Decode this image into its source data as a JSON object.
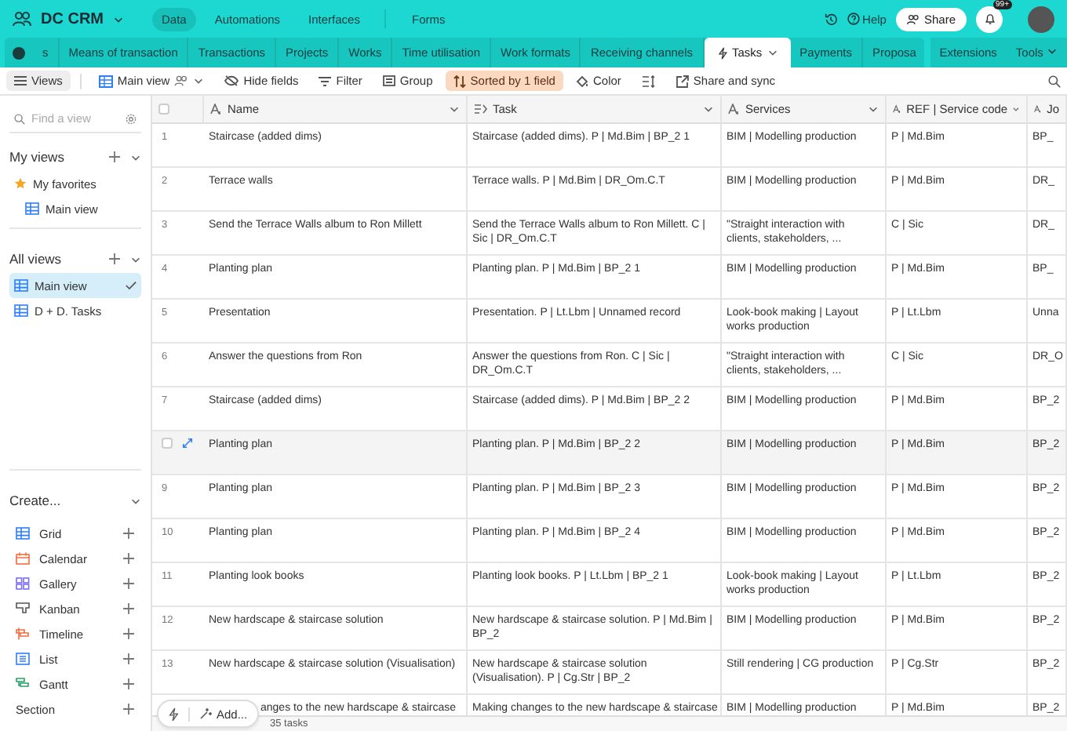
{
  "topbar": {
    "base_name": "DC CRM",
    "nav": [
      {
        "label": "Data",
        "selected": true
      },
      {
        "label": "Automations",
        "selected": false
      },
      {
        "label": "Interfaces",
        "selected": false
      },
      {
        "label": "Forms",
        "selected": false
      }
    ],
    "help": "Help",
    "share": "Share",
    "notification_badge": "99+"
  },
  "tables": {
    "tabs": [
      {
        "label": "s",
        "selected": false
      },
      {
        "label": "Means of transaction",
        "selected": false
      },
      {
        "label": "Transactions",
        "selected": false
      },
      {
        "label": "Projects",
        "selected": false
      },
      {
        "label": "Works",
        "selected": false
      },
      {
        "label": "Time utilisation",
        "selected": false
      },
      {
        "label": "Work formats",
        "selected": false
      },
      {
        "label": "Receiving channels",
        "selected": false
      },
      {
        "label": "Tasks",
        "selected": true
      },
      {
        "label": "Payments",
        "selected": false
      },
      {
        "label": "Proposa",
        "selected": false
      }
    ],
    "extensions": "Extensions",
    "tools": "Tools"
  },
  "toolbar": {
    "items": [
      {
        "label": "Views",
        "kind": "views",
        "active": false
      },
      {
        "label": "Main view",
        "kind": "view",
        "active": false
      },
      {
        "label": "Hide fields",
        "kind": "hide",
        "active": false
      },
      {
        "label": "Filter",
        "kind": "filter",
        "active": false
      },
      {
        "label": "Group",
        "kind": "group",
        "active": false
      },
      {
        "label": "Sorted by 1 field",
        "kind": "sort",
        "active": true
      },
      {
        "label": "Color",
        "kind": "color",
        "active": false
      },
      {
        "label": "Share and sync",
        "kind": "share",
        "active": false
      }
    ]
  },
  "sidebar": {
    "search": {
      "placeholder": "Find a view"
    },
    "my_views": "My views",
    "favorites": "My favorites",
    "favorite_items": [
      {
        "label": "Main view"
      }
    ],
    "all_views": "All views",
    "views": [
      {
        "label": "Main view",
        "selected": true
      },
      {
        "label": "D + D. Tasks",
        "selected": false
      }
    ],
    "create": "Create...",
    "create_items": [
      {
        "label": "Grid",
        "kind": "grid"
      },
      {
        "label": "Calendar",
        "kind": "calendar"
      },
      {
        "label": "Gallery",
        "kind": "gallery"
      },
      {
        "label": "Kanban",
        "kind": "kanban"
      },
      {
        "label": "Timeline",
        "kind": "timeline"
      },
      {
        "label": "List",
        "kind": "list"
      },
      {
        "label": "Gantt",
        "kind": "gantt"
      },
      {
        "label": "Section",
        "kind": "section"
      }
    ]
  },
  "table": {
    "columns": [
      {
        "label": "Name",
        "kind": "text"
      },
      {
        "label": "Task",
        "kind": "formula"
      },
      {
        "label": "Services",
        "kind": "text"
      },
      {
        "label": "REF | Service code",
        "kind": "text"
      },
      {
        "label": "Jo",
        "kind": "text"
      }
    ],
    "rows": [
      {
        "number": "1",
        "hovered": false,
        "cells": [
          "Staircase (added dims)",
          "Staircase (added dims). P | Md.Bim | BP_2 1",
          "BIM | Modelling production",
          "P | Md.Bim",
          "BP_"
        ]
      },
      {
        "number": "2",
        "hovered": false,
        "cells": [
          "Terrace walls",
          "Terrace walls. P | Md.Bim | DR_Om.C.T",
          "BIM | Modelling production",
          "P | Md.Bim",
          "DR_"
        ]
      },
      {
        "number": "3",
        "hovered": false,
        "cells": [
          "Send the Terrace Walls album to Ron Millett",
          "Send the Terrace Walls album to Ron Millett. C | Sic | DR_Om.C.T",
          "\"Straight interaction with clients, stakeholders, ...",
          "C | Sic",
          "DR_"
        ]
      },
      {
        "number": "4",
        "hovered": false,
        "cells": [
          "Planting plan",
          "Planting plan. P | Md.Bim | BP_2 1",
          "BIM | Modelling production",
          "P | Md.Bim",
          "BP_"
        ]
      },
      {
        "number": "5",
        "hovered": false,
        "cells": [
          "Presentation",
          "Presentation. P | Lt.Lbm | Unnamed record",
          "Look-book making | Layout works production",
          "P | Lt.Lbm",
          "Unna"
        ]
      },
      {
        "number": "6",
        "hovered": false,
        "cells": [
          "Answer the questions from Ron",
          "Answer the questions from Ron. C | Sic | DR_Om.C.T",
          "\"Straight interaction with clients, stakeholders, ...",
          "C | Sic",
          "DR_O"
        ]
      },
      {
        "number": "7",
        "hovered": false,
        "cells": [
          "Staircase (added dims)",
          "Staircase (added dims). P | Md.Bim | BP_2 2",
          "BIM | Modelling production",
          "P | Md.Bim",
          "BP_2"
        ]
      },
      {
        "hovered": true,
        "cells": [
          "Planting plan",
          "Planting plan. P | Md.Bim | BP_2 2",
          "BIM | Modelling production",
          "P | Md.Bim",
          "BP_2"
        ]
      },
      {
        "number": "9",
        "hovered": false,
        "cells": [
          "Planting plan",
          "Planting plan. P | Md.Bim | BP_2 3",
          "BIM | Modelling production",
          "P | Md.Bim",
          "BP_2"
        ]
      },
      {
        "number": "10",
        "hovered": false,
        "cells": [
          "Planting plan",
          "Planting plan. P | Md.Bim | BP_2 4",
          "BIM | Modelling production",
          "P | Md.Bim",
          "BP_2"
        ]
      },
      {
        "number": "11",
        "hovered": false,
        "cells": [
          "Planting look books",
          "Planting look books. P | Lt.Lbm | BP_2 1",
          "Look-book making | Layout works production",
          "P | Lt.Lbm",
          "BP_2"
        ]
      },
      {
        "number": "12",
        "hovered": false,
        "cells": [
          "New hardscape & staircase solution",
          "New hardscape & staircase solution. P | Md.Bim | BP_2",
          "BIM | Modelling production",
          "P | Md.Bim",
          "BP_2"
        ]
      },
      {
        "number": "13",
        "hovered": false,
        "cells": [
          "New hardscape & staircase solution (Visualisation)",
          "New hardscape & staircase solution (Visualisation). P | Cg.Str | BP_2",
          "Still rendering | CG production",
          "P | Cg.Str",
          "BP_2"
        ]
      },
      {
        "hovered": false,
        "cells": [
          "anges to the new hardscape & staircase",
          "Making changes to the new hardscape & staircase",
          "BIM | Modelling production",
          "P | Md.Bim",
          "BP_2"
        ]
      }
    ],
    "select_all": {
      "checked": false
    },
    "add_label": "Add...",
    "count": "35 tasks"
  }
}
